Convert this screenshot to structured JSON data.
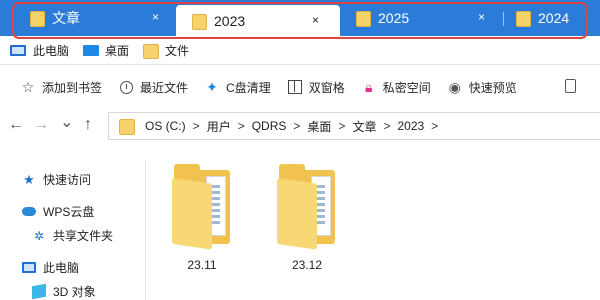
{
  "tabs": [
    {
      "label": "文章",
      "active": false
    },
    {
      "label": "2023",
      "active": true
    },
    {
      "label": "2025",
      "active": false
    },
    {
      "label": "2024",
      "active": false
    }
  ],
  "tab_close_glyph": "×",
  "quick_access": [
    {
      "label": "此电脑",
      "icon": "computer-icon"
    },
    {
      "label": "桌面",
      "icon": "desktop-icon"
    },
    {
      "label": "文件",
      "icon": "folder-icon"
    }
  ],
  "toolbar": {
    "bookmark": "添加到书签",
    "recent": "最近文件",
    "cleanup": "C盘清理",
    "dual_pane": "双窗格",
    "private": "私密空间",
    "preview": "快速预览"
  },
  "nav": {
    "back": "←",
    "forward": "→",
    "dropdown": "⌄",
    "up": "↑"
  },
  "address": {
    "crumbs": [
      "OS (C:)",
      "用户",
      "QDRS",
      "桌面",
      "文章",
      "2023"
    ],
    "separator": ">"
  },
  "sidebar": [
    {
      "label": "快速访问",
      "icon": "star-icon"
    },
    {
      "label": "WPS云盘",
      "icon": "cloud-icon"
    },
    {
      "label": "共享文件夹",
      "icon": "share-icon"
    },
    {
      "label": "此电脑",
      "icon": "computer-icon"
    },
    {
      "label": "3D 对象",
      "icon": "cube-icon"
    }
  ],
  "folders": [
    {
      "label": "23.11"
    },
    {
      "label": "23.12"
    }
  ],
  "colors": {
    "tabbar": "#2b7bd8",
    "highlight": "#e0443e",
    "folder": "#f2c24f"
  }
}
